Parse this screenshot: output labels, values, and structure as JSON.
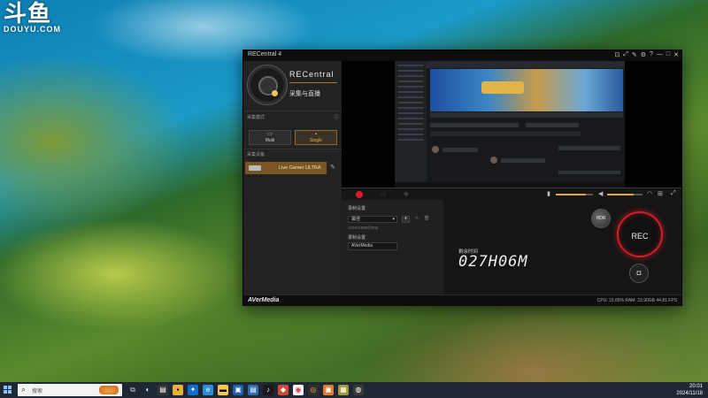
{
  "watermark": {
    "logo": "斗鱼",
    "site": "DOUYU.COM"
  },
  "window": {
    "title": "RECentral 4",
    "controls": [
      "⊡",
      "⤢",
      "✎",
      "⚙",
      "?",
      "—",
      "□",
      "✕"
    ]
  },
  "sidebar": {
    "brand": "RECentral",
    "subtitle": "采集与直播",
    "mode_section": "采集模式",
    "modes": [
      {
        "label": "Multi"
      },
      {
        "label": "Single"
      }
    ],
    "device_section": "采集设备",
    "device": "Live Gamer ULTRA"
  },
  "settings": {
    "section": "录制设置",
    "preset": "最佳",
    "quality_row": "1920x1080@60p",
    "file_section": "录制设置",
    "folder": "AVerMedia"
  },
  "recorder": {
    "elapsed_label": "剩余时间",
    "elapsed": "027H06M",
    "hdr_label": "HDR",
    "rec_label": "REC"
  },
  "status": {
    "logo": "AVerMedia",
    "stats": "CPU: 15.65%  RAM: 23.90GB  44.81 FPS"
  },
  "taskbar": {
    "search_placeholder": "搜索",
    "time": "20:01",
    "date": "2024/11/18"
  }
}
